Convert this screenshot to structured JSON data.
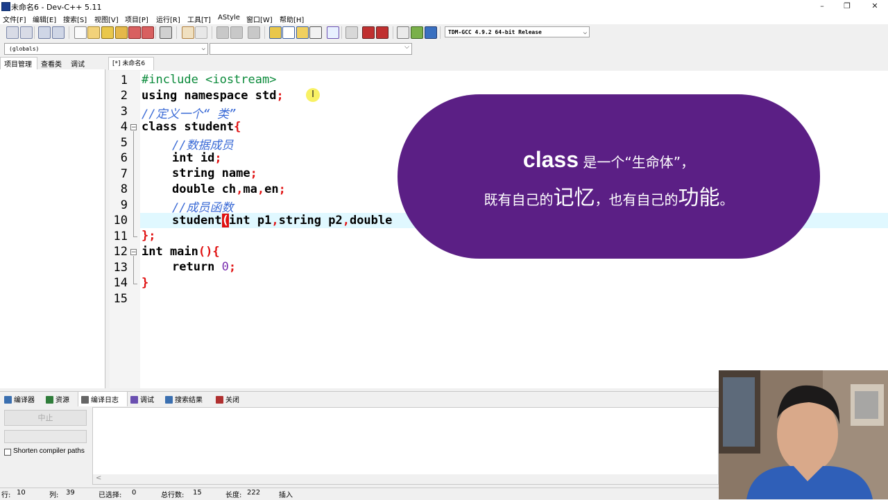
{
  "window": {
    "title": "未命名6 - Dev-C++ 5.11",
    "controls": [
      "–",
      "❐",
      "✕"
    ]
  },
  "menu": [
    "文件[F]",
    "编辑[E]",
    "搜索[S]",
    "视图[V]",
    "项目[P]",
    "运行[R]",
    "工具[T]",
    "AStyle",
    "窗口[W]",
    "帮助[H]"
  ],
  "toolbar": {
    "compiler": "TDM-GCC 4.9.2 64-bit Release"
  },
  "combos": {
    "scope": "(globals)",
    "member": ""
  },
  "left_tabs": [
    "项目管理",
    "查看类",
    "调试"
  ],
  "editor": {
    "tab": "[*] 未命名6",
    "line_numbers": [
      "1",
      "2",
      "3",
      "4",
      "5",
      "6",
      "7",
      "8",
      "9",
      "10",
      "11",
      "12",
      "13",
      "14",
      "15"
    ],
    "lines": {
      "l1": "#include <iostream>",
      "l2a": "using namespace std",
      "l2b": ";",
      "l3": "//定义一个“ 类”",
      "l4a": "class student",
      "l4b": "{",
      "l5": "//数据成员",
      "l6a": "int id",
      "l6b": ";",
      "l7a": "string name",
      "l7b": ";",
      "l8a": "double ch",
      "l8b": ",",
      "l8c": "ma",
      "l8d": ",",
      "l8e": "en",
      "l8f": ";",
      "l9": "//成员函数",
      "l10a": "student",
      "l10b": "(",
      "l10c": "int p1",
      "l10d": ",",
      "l10e": "string p2",
      "l10f": ",",
      "l10g": "double",
      "l11": "};",
      "l12a": "int main",
      "l12b": "(){",
      "l13a": "return ",
      "l13b": "0",
      "l13c": ";",
      "l14": "}"
    }
  },
  "overlay": {
    "line1_big": "class",
    "line1_rest": " 是一个“生命体”，",
    "line2_a": "既有自己的",
    "line2_b": "记忆",
    "line2_c": "，也有自己的",
    "line2_d": "功能",
    "line2_e": "。"
  },
  "bottom_tabs": [
    "编译器",
    "资源",
    "编译日志",
    "调试",
    "搜索结果",
    "关闭"
  ],
  "bottom_panel": {
    "stop_label": "中止",
    "shorten_label": "Shorten compiler paths",
    "scroll_glyph": "<"
  },
  "status": {
    "row_label": "行:",
    "row": "10",
    "col_label": "列:",
    "col": "39",
    "sel_label": "已选择:",
    "sel": "0",
    "total_label": "总行数:",
    "total": "15",
    "len_label": "长度:",
    "len": "222",
    "mode": "插入"
  },
  "icons": {
    "app": "devcpp-icon",
    "tab_colors": [
      "#3a6fb0",
      "#2f7d3a",
      "#666666",
      "#6a4fb0",
      "#3a6fb0",
      "#b03030"
    ]
  },
  "colors": {
    "overlay_bg": "#5b1f85",
    "current_line": "#e0f8ff",
    "preprocessor": "#0a8a3a",
    "comment": "#3b6bd6",
    "symbol": "#e01010"
  }
}
